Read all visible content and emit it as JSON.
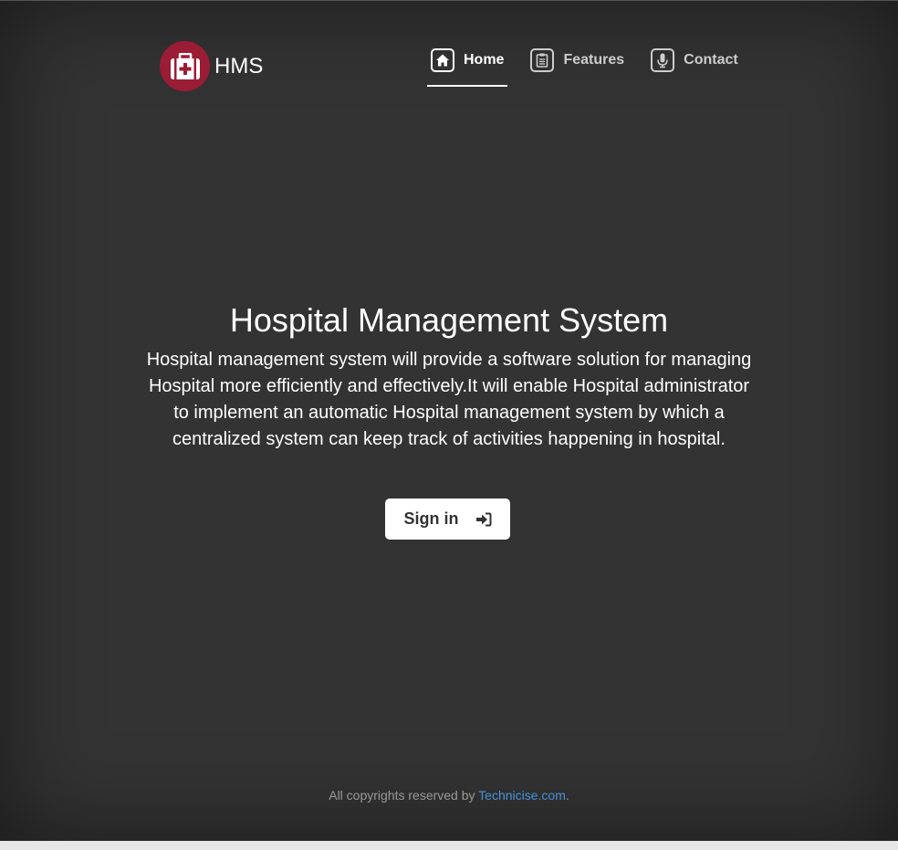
{
  "brand": {
    "name": "HMS",
    "logo_icon": "first-aid-kit-icon",
    "logo_color": "#9b1c35"
  },
  "nav": {
    "items": [
      {
        "label": "Home",
        "icon": "home-icon",
        "active": true
      },
      {
        "label": "Features",
        "icon": "clipboard-icon",
        "active": false
      },
      {
        "label": "Contact",
        "icon": "microphone-icon",
        "active": false
      }
    ]
  },
  "hero": {
    "title": "Hospital Management System",
    "description": "Hospital management system will provide a software solution for managing Hospital more efficiently and effectively.It will enable Hospital administrator to implement an automatic Hospital management system by which a centralized system can keep track of activities happening in hospital.",
    "signin_label": "Sign in",
    "signin_icon": "sign-in-icon"
  },
  "footer": {
    "text": "All copyrights reserved by ",
    "link_text": "Technicise.com",
    "trailing": "."
  },
  "colors": {
    "background": "#333333",
    "accent": "#9b1c35",
    "link": "#4a90d9"
  }
}
